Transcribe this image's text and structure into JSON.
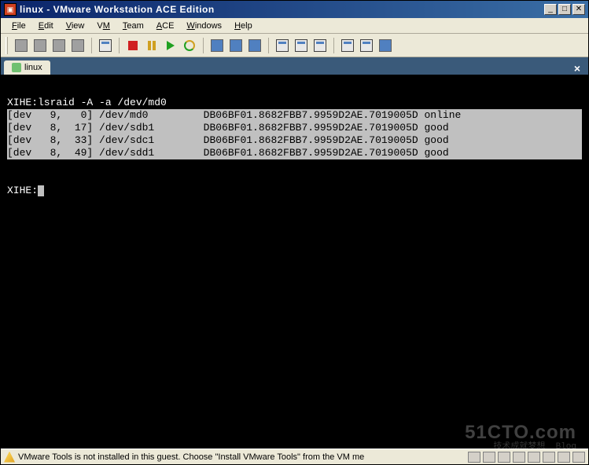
{
  "window": {
    "title": "linux - VMware Workstation ACE Edition"
  },
  "menu": {
    "file": "File",
    "edit": "Edit",
    "view": "View",
    "vm": "VM",
    "team": "Team",
    "ace": "ACE",
    "windows": "Windows",
    "help": "Help"
  },
  "tab": {
    "label": "linux"
  },
  "terminal": {
    "command": "XIHE:lsraid -A -a /dev/md0",
    "rows": [
      "[dev   9,   0] /dev/md0         DB06BF01.8682FBB7.9959D2AE.7019005D online",
      "[dev   8,  17] /dev/sdb1        DB06BF01.8682FBB7.9959D2AE.7019005D good",
      "[dev   8,  33] /dev/sdc1        DB06BF01.8682FBB7.9959D2AE.7019005D good",
      "[dev   8,  49] /dev/sdd1        DB06BF01.8682FBB7.9959D2AE.7019005D good"
    ],
    "prompt": "XIHE:"
  },
  "watermark": {
    "main": "51CTO.com",
    "sub": "技术成就梦想  Blog"
  },
  "status": {
    "message": "VMware Tools is not installed in this guest. Choose \"Install VMware Tools\" from the VM me"
  }
}
